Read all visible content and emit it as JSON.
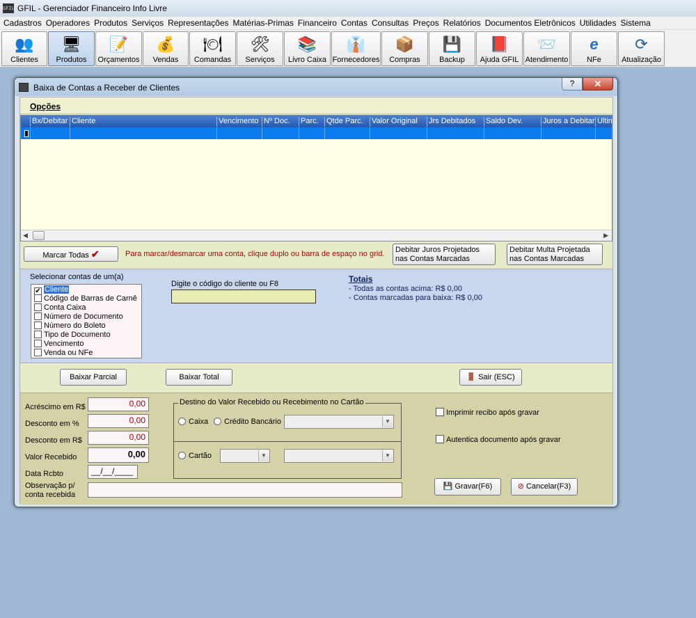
{
  "app": {
    "title": "GFIL - Gerenciador Financeiro Info Livre",
    "icon_text": "GFIL"
  },
  "menu": [
    "Cadastros",
    "Operadores",
    "Produtos",
    "Serviços",
    "Representações",
    "Matérias-Primas",
    "Financeiro",
    "Contas",
    "Consultas",
    "Preços",
    "Relatórios",
    "Documentos Eletrônicos",
    "Utilidades",
    "Sistema"
  ],
  "toolbar": [
    {
      "label": "Clientes",
      "icon": "users-icon"
    },
    {
      "label": "Produtos",
      "icon": "monitor-icon"
    },
    {
      "label": "Orçamentos",
      "icon": "person-writing-icon"
    },
    {
      "label": "Vendas",
      "icon": "money-bag-icon"
    },
    {
      "label": "Comandas",
      "icon": "plate-cutlery-icon"
    },
    {
      "label": "Serviços",
      "icon": "tools-icon"
    },
    {
      "label": "Livro Caixa",
      "icon": "books-icon"
    },
    {
      "label": "Fornecedores",
      "icon": "businessman-icon"
    },
    {
      "label": "Compras",
      "icon": "boxes-icon"
    },
    {
      "label": "Backup",
      "icon": "floppy-icon"
    },
    {
      "label": "Ajuda GFIL",
      "icon": "help-book-icon"
    },
    {
      "label": "Atendimento",
      "icon": "screen-arrow-icon"
    },
    {
      "label": "NFe",
      "icon": "nfe-icon"
    },
    {
      "label": "Atualização",
      "icon": "update-icon"
    }
  ],
  "dialog": {
    "title": "Baixa de Contas a Receber de Clientes",
    "help": "?",
    "close": "✕",
    "opcoes": "Opções"
  },
  "grid": {
    "columns": [
      "Bx/Debitar",
      "Cliente",
      "Vencimento",
      "Nº Doc.",
      "Parc.",
      "Qtde Parc.",
      "Valor Original",
      "Jrs Debitados",
      "Saldo Dev.",
      "Juros a Debitar",
      "Últim"
    ]
  },
  "actions": {
    "marcar_todas": "Marcar Todas",
    "hint": "Para marcar/desmarcar uma conta, clique duplo ou barra de espaço no grid.",
    "debitar_juros": "Debitar Juros Projetados nas Contas Marcadas",
    "debitar_multa": "Debitar Multa Projetada nas Contas Marcadas"
  },
  "selecionar": {
    "label": "Selecionar contas de um(a)",
    "items": [
      {
        "label": "Cliente",
        "checked": true
      },
      {
        "label": "Código de Barras de Carnê",
        "checked": false
      },
      {
        "label": "Conta Caixa",
        "checked": false
      },
      {
        "label": "Número de Documento",
        "checked": false
      },
      {
        "label": "Número do Boleto",
        "checked": false
      },
      {
        "label": "Tipo de Documento",
        "checked": false
      },
      {
        "label": "Vencimento",
        "checked": false
      },
      {
        "label": "Venda ou NFe",
        "checked": false
      }
    ],
    "codigo_label": "Digite o código do cliente ou F8",
    "codigo_value": ""
  },
  "totais": {
    "title": "Totais",
    "todas": "- Todas as contas acima: R$ 0,00",
    "marcadas": "- Contas marcadas para baixa: R$ 0,00"
  },
  "baixa": {
    "parcial": "Baixar Parcial",
    "total": "Baixar Total",
    "sair": "Sair (ESC)"
  },
  "valores": {
    "acrescimo_label": "Acréscimo em R$",
    "acrescimo": "0,00",
    "desconto_pct_label": "Desconto em %",
    "desconto_pct": "0,00",
    "desconto_rs_label": "Desconto em R$",
    "desconto_rs": "0,00",
    "recebido_label": "Valor Recebido",
    "recebido": "0,00",
    "data_label": "Data Rcbto",
    "data": "__/__/____",
    "obs_label": "Observação p/ conta recebida",
    "obs": ""
  },
  "destino": {
    "title": "Destino do Valor Recebido ou Recebimento no Cartão",
    "caixa": "Caixa",
    "credito": "Crédito Bancário",
    "cartao": "Cartão"
  },
  "opcoes_gravar": {
    "imprimir": "Imprimir recibo após gravar",
    "autentica": "Autentica documento após gravar",
    "gravar": "Gravar(F6)",
    "cancelar": "Cancelar(F3)"
  }
}
